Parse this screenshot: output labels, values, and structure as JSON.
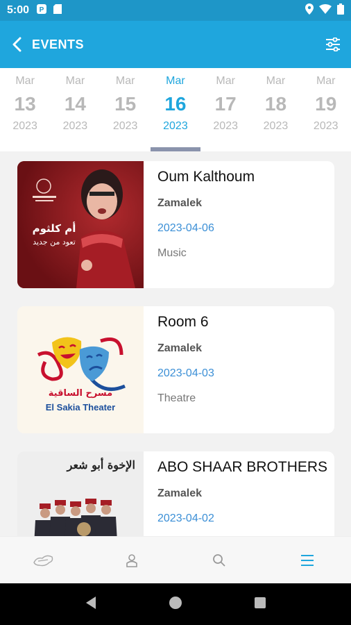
{
  "status_bar": {
    "time": "5:00"
  },
  "app_bar": {
    "title": "EVENTS"
  },
  "dates": [
    {
      "month": "Mar",
      "day": "13",
      "year": "2023",
      "selected": false
    },
    {
      "month": "Mar",
      "day": "14",
      "year": "2023",
      "selected": false
    },
    {
      "month": "Mar",
      "day": "15",
      "year": "2023",
      "selected": false
    },
    {
      "month": "Mar",
      "day": "16",
      "year": "2023",
      "selected": true
    },
    {
      "month": "Mar",
      "day": "17",
      "year": "2023",
      "selected": false
    },
    {
      "month": "Mar",
      "day": "18",
      "year": "2023",
      "selected": false
    },
    {
      "month": "Mar",
      "day": "19",
      "year": "2023",
      "selected": false
    }
  ],
  "events": [
    {
      "title": "Oum Kalthoum",
      "venue": "Zamalek",
      "date": "2023-04-06",
      "category": "Music",
      "poster_text": "أم كلثوم",
      "poster_subtext": "تعود من جديد"
    },
    {
      "title": "Room 6",
      "venue": "Zamalek",
      "date": "2023-04-03",
      "category": "Theatre",
      "poster_text": "مسرح الساقية",
      "poster_subtext": "El Sakia Theater"
    },
    {
      "title": "ABO SHAAR BROTHERS",
      "venue": "Zamalek",
      "date": "2023-04-02",
      "category": "",
      "poster_text": "الإخوة أبو شعر"
    }
  ],
  "colors": {
    "primary": "#1fa6dd",
    "status_bar": "#1e96c8",
    "date_link": "#3b8fd6",
    "selected_underline": "#8a93ac"
  },
  "bottom_nav": [
    "logo-icon",
    "profile-icon",
    "search-icon",
    "menu-icon"
  ]
}
